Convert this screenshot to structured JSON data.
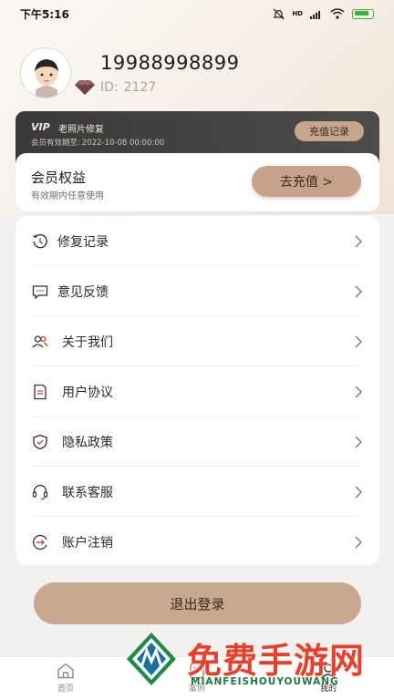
{
  "status_bar": {
    "time": "下午5:16",
    "network": "HD",
    "battery": ""
  },
  "profile": {
    "phone": "19988998899",
    "uid_prefix": "ID:",
    "uid": "2127"
  },
  "vip_card": {
    "logo": "VIP",
    "title": "老照片修复",
    "expire_label": "会员有效期至:",
    "expire_date": "2022-10-08 00:00:00",
    "record_button": "充值记录"
  },
  "benefit": {
    "title": "会员权益",
    "subtitle": "有效期内任意使用",
    "button": "去充值 >"
  },
  "menu": {
    "items": [
      {
        "label": "修复记录",
        "icon": "history-icon"
      },
      {
        "label": "意见反馈",
        "icon": "feedback-icon"
      },
      {
        "label": "关于我们",
        "icon": "users-icon"
      },
      {
        "label": "用户协议",
        "icon": "document-icon"
      },
      {
        "label": "隐私政策",
        "icon": "shield-icon"
      },
      {
        "label": "联系客服",
        "icon": "customer-service-icon"
      },
      {
        "label": "账户注销",
        "icon": "account-cancel-icon"
      }
    ]
  },
  "logout_button": "退出登录",
  "tabbar": {
    "tabs": [
      {
        "label": "首页",
        "icon": "home-icon"
      },
      {
        "label": "案例",
        "icon": "case-icon"
      },
      {
        "label": "我的",
        "icon": "profile-icon"
      }
    ]
  },
  "watermark": {
    "text": "免费手游网",
    "sub": "MIANFEISHOUYOUWANG"
  },
  "colors": {
    "accent": "#c6a28a",
    "vip_card_bg": "#3a3939",
    "watermark_red": "#e8402a",
    "watermark_green": "#1d7a3d"
  }
}
